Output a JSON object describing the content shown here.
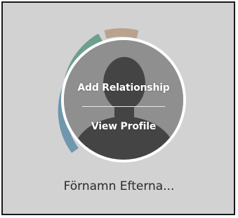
{
  "profile": {
    "name": "Förnamn Efterna...",
    "actions": {
      "add_relationship": "Add Relationship",
      "view_profile": "View Profile"
    }
  },
  "ring_segments": [
    {
      "name": "blue",
      "color": "#6f97ad"
    },
    {
      "name": "green",
      "color": "#6e9e8e"
    },
    {
      "name": "tan",
      "color": "#b9a28f"
    }
  ],
  "icons": {
    "avatar": "person-silhouette-icon"
  }
}
